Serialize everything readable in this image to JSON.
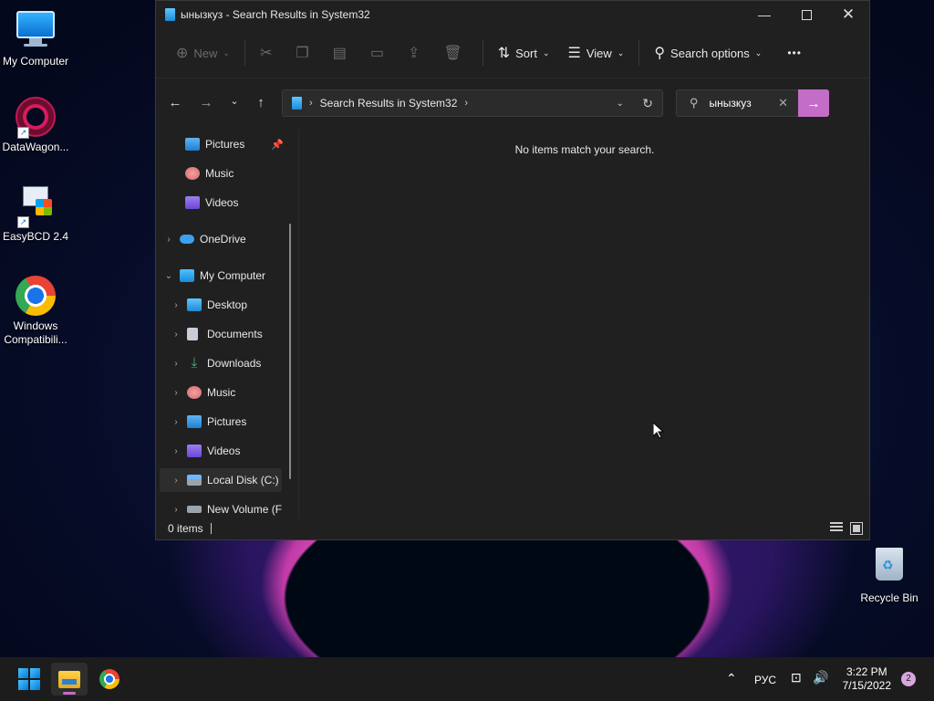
{
  "desktop": {
    "icons": [
      {
        "label": "My Computer"
      },
      {
        "label": "DataWagon..."
      },
      {
        "label": "EasyBCD 2.4"
      },
      {
        "label": "Windows Compatibili..."
      },
      {
        "label": "Recycle Bin"
      }
    ]
  },
  "explorer": {
    "title": "ынызкуз - Search Results in System32",
    "toolbar": {
      "new_label": "New",
      "sort_label": "Sort",
      "view_label": "View",
      "search_options_label": "Search options",
      "more_label": "•••"
    },
    "address": {
      "crumb": "Search Results in System32"
    },
    "search": {
      "query": "ынызкуз"
    },
    "sidebar": {
      "items": [
        {
          "label": "Pictures",
          "icon": "pictures-icon"
        },
        {
          "label": "Music",
          "icon": "music-icon"
        },
        {
          "label": "Videos",
          "icon": "videos-icon"
        },
        {
          "label": "OneDrive",
          "icon": "onedrive-icon"
        },
        {
          "label": "My Computer",
          "icon": "computer-icon"
        },
        {
          "label": "Desktop",
          "icon": "desktop-icon"
        },
        {
          "label": "Documents",
          "icon": "documents-icon"
        },
        {
          "label": "Downloads",
          "icon": "downloads-icon"
        },
        {
          "label": "Music",
          "icon": "music-icon"
        },
        {
          "label": "Pictures",
          "icon": "pictures-icon"
        },
        {
          "label": "Videos",
          "icon": "videos-icon"
        },
        {
          "label": "Local Disk (C:)",
          "icon": "drive-icon"
        },
        {
          "label": "New Volume (F",
          "icon": "drive-icon"
        }
      ]
    },
    "main": {
      "empty_message": "No items match your search."
    },
    "status": {
      "count": "0 items"
    }
  },
  "taskbar": {
    "tray": {
      "language": "РУС"
    },
    "clock": {
      "time": "3:22 PM",
      "date": "7/15/2022"
    },
    "notifications": "2"
  },
  "colors": {
    "accent": "#c46dc8",
    "window_bg": "#202020",
    "taskbar_bg": "#1c1c1c"
  }
}
